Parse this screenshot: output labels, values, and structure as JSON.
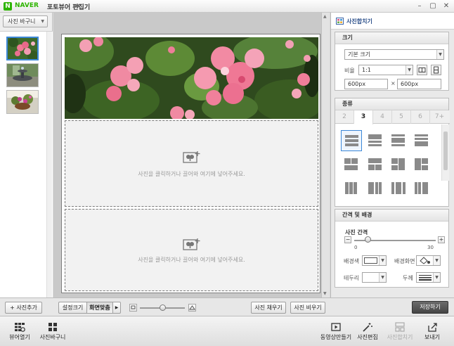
{
  "window": {
    "brand": "NAVER",
    "title": "포토뷰어 편집기",
    "minimize_icon": "minimize-icon",
    "maximize_icon": "maximize-icon",
    "close_icon": "close-icon"
  },
  "left_panel": {
    "basket_label": "사진 바구니",
    "add_photo_label": "+ 사진추가",
    "thumbnails": [
      "flowers-thumbnail",
      "fountain-thumbnail",
      "flower-basket-thumbnail"
    ]
  },
  "canvas": {
    "drop_hint": "사진을 클릭하거나 끌어와 여기에 넣어주세요.",
    "empty_cells": 2
  },
  "canvas_toolbar": {
    "set_size_label": "설정크기",
    "fit_screen_label": "화면맞춤",
    "fill_photos_label": "사진 채우기",
    "clear_photos_label": "사진 비우기"
  },
  "right_panel": {
    "header": "사진합치기",
    "size_section": {
      "title": "크기",
      "preset_value": "기본 크기",
      "ratio_label": "비율",
      "ratio_value": "1:1",
      "width_value": "600px",
      "times_sign": "×",
      "height_value": "600px"
    },
    "type_section": {
      "title": "종류",
      "tabs": [
        "2",
        "3",
        "4",
        "5",
        "6",
        "7+"
      ],
      "active_tab": "3"
    },
    "spacing_section": {
      "title": "간격 및 배경",
      "spacing_label": "사진 간격",
      "spacing_min": "0",
      "spacing_max": "30",
      "spacing_value": 5,
      "bg_color_label": "배경색",
      "bg_image_label": "배경화면",
      "border_label": "테두리",
      "thickness_label": "두께"
    },
    "save_label": "저장하기"
  },
  "bottom_toolbar": {
    "viewer_open": "뷰어열기",
    "photo_basket": "사진바구니",
    "make_video": "동영상만들기",
    "photo_edit": "사진편집",
    "photo_merge": "사진합치기",
    "send": "보내기"
  },
  "zoom": {
    "level": 0.5
  }
}
